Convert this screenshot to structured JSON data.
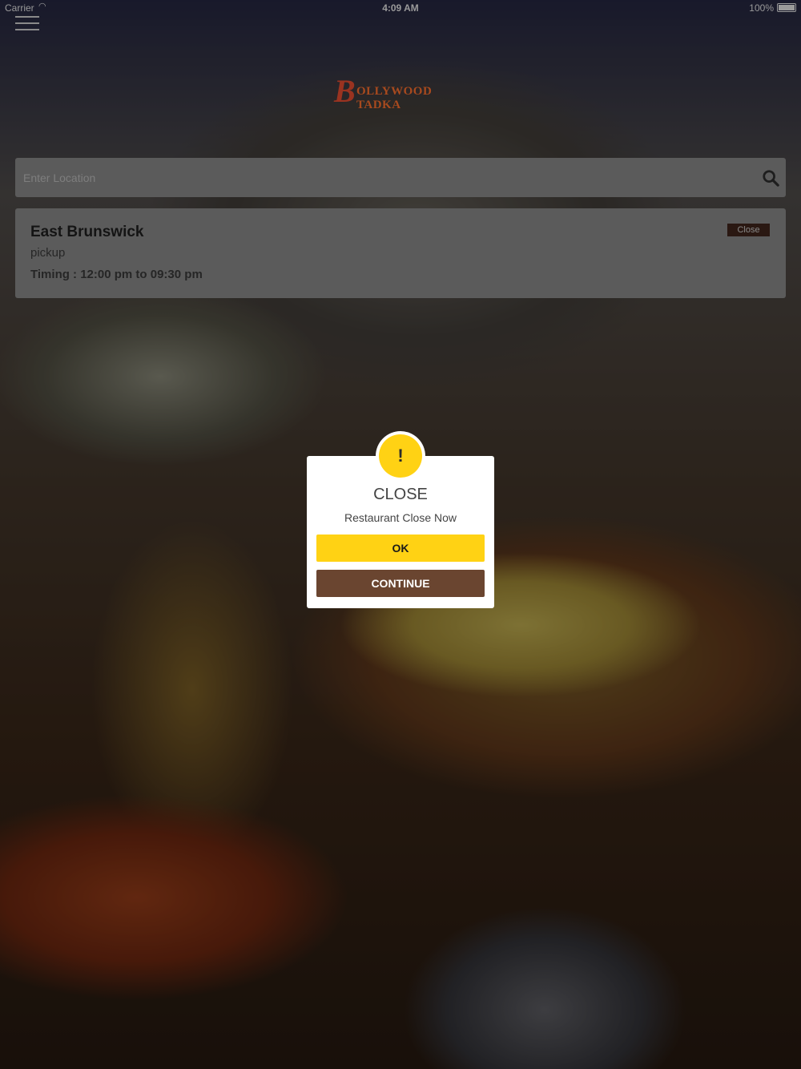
{
  "status_bar": {
    "carrier": "Carrier",
    "time": "4:09 AM",
    "battery": "100%"
  },
  "header": {
    "logo_text": "OLLYWOOD TADKA",
    "logo_initial": "B"
  },
  "search": {
    "placeholder": "Enter Location"
  },
  "restaurant": {
    "name": "East Brunswick",
    "mode": "pickup",
    "timing": "Timing : 12:00 pm to 09:30 pm",
    "status_badge": "Close"
  },
  "dialog": {
    "icon_symbol": "!",
    "title": "CLOSE",
    "message": "Restaurant Close Now",
    "ok_label": "OK",
    "continue_label": "CONTINUE"
  },
  "colors": {
    "accent_yellow": "#ffd214",
    "accent_brown": "#6a4530"
  }
}
